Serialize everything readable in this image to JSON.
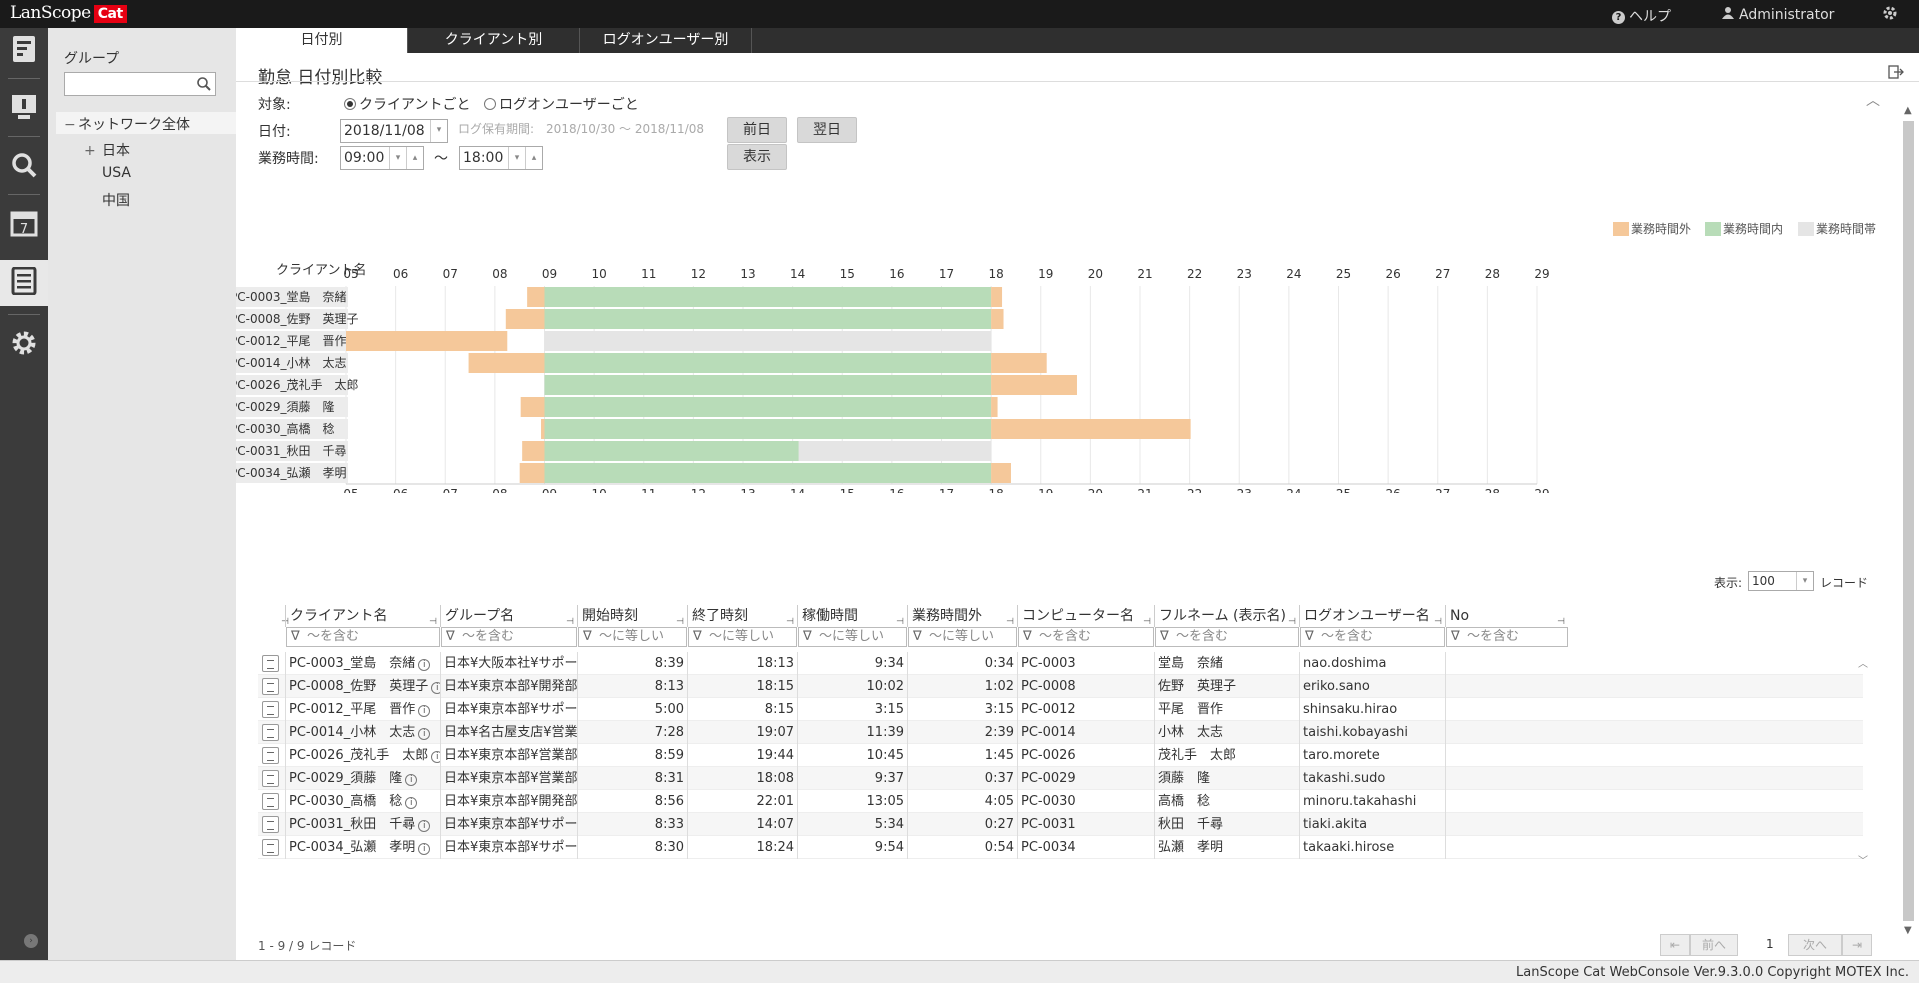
{
  "app": {
    "logo_text": "LanScope",
    "logo_badge": "Cat"
  },
  "topbar": {
    "help": "ヘルプ",
    "user": "Administrator"
  },
  "sidepanel": {
    "title": "グループ",
    "search_placeholder": "",
    "tree": [
      {
        "label": "ネットワーク全体",
        "toggle": "−"
      },
      {
        "label": "日本",
        "toggle": "+"
      },
      {
        "label": "USA",
        "toggle": ""
      },
      {
        "label": "中国",
        "toggle": ""
      }
    ]
  },
  "tabs": [
    {
      "label": "日付別",
      "active": true
    },
    {
      "label": "クライアント別",
      "active": false
    },
    {
      "label": "ログオンユーザー別",
      "active": false
    }
  ],
  "page": {
    "title": "勤怠 日付別比較"
  },
  "form": {
    "target_label": "対象:",
    "radio_client": "クライアントごと",
    "radio_user": "ログオンユーザーごと",
    "date_label": "日付:",
    "date_value": "2018/11/08",
    "log_period": "ログ保有期間:　2018/10/30 ～ 2018/11/08",
    "prev_button": "前日",
    "next_button": "翌日",
    "hours_label": "業務時間:",
    "start_time": "09:00",
    "tilde": "～",
    "end_time": "18:00",
    "show_button": "表示"
  },
  "legend": {
    "outside": "業務時間外",
    "inside": "業務時間内",
    "band": "業務時間帯",
    "outside_color": "#f5c89a",
    "inside_color": "#b8dcb8",
    "band_color": "#e5e5e5"
  },
  "chart_data": {
    "type": "bar",
    "title": "",
    "category_header": "クライアント名",
    "x_ticks": [
      "05",
      "06",
      "07",
      "08",
      "09",
      "10",
      "11",
      "12",
      "13",
      "14",
      "15",
      "16",
      "17",
      "18",
      "19",
      "20",
      "21",
      "22",
      "23",
      "24",
      "25",
      "26",
      "27",
      "28",
      "29"
    ],
    "xlim": [
      5,
      29
    ],
    "business_hours": [
      9,
      18
    ],
    "categories": [
      "PC-0003_堂島　奈緒",
      "PC-0008_佐野　英理子",
      "PC-0012_平尾　晋作",
      "PC-0014_小林　太志",
      "PC-0026_茂礼手　太郎",
      "PC-0029_須藤　隆",
      "PC-0030_高橋　稔",
      "PC-0031_秋田　千尋",
      "PC-0034_弘瀬　孝明"
    ],
    "series": [
      {
        "name": "業務時間外",
        "ranges": [
          [
            [
              8.65,
              9
            ],
            [
              18,
              18.22
            ]
          ],
          [
            [
              8.22,
              9
            ],
            [
              18,
              18.25
            ]
          ],
          [
            [
              5,
              8.25
            ]
          ],
          [
            [
              7.47,
              9
            ],
            [
              18,
              19.12
            ]
          ],
          [
            [
              9,
              9
            ],
            [
              18,
              19.73
            ]
          ],
          [
            [
              8.52,
              9
            ],
            [
              18,
              18.13
            ]
          ],
          [
            [
              8.93,
              9
            ],
            [
              18,
              22.02
            ]
          ],
          [
            [
              8.55,
              9
            ]
          ],
          [
            [
              8.5,
              9
            ],
            [
              18,
              18.4
            ]
          ]
        ]
      },
      {
        "name": "業務時間内",
        "ranges": [
          [
            [
              9,
              18
            ]
          ],
          [
            [
              9,
              18
            ]
          ],
          [],
          [
            [
              9,
              18
            ]
          ],
          [
            [
              9,
              18
            ]
          ],
          [
            [
              9,
              18
            ]
          ],
          [
            [
              9,
              18
            ]
          ],
          [
            [
              9,
              14.12
            ]
          ],
          [
            [
              9,
              18
            ]
          ]
        ]
      }
    ]
  },
  "grid": {
    "display_label": "表示:",
    "page_size": "100",
    "records_label": "レコード",
    "columns": [
      {
        "label": "クライアント名",
        "filter": "～を含む"
      },
      {
        "label": "グループ名",
        "filter": "～を含む"
      },
      {
        "label": "開始時刻",
        "filter": "～に等しい"
      },
      {
        "label": "終了時刻",
        "filter": "～に等しい"
      },
      {
        "label": "稼働時間",
        "filter": "～に等しい"
      },
      {
        "label": "業務時間外",
        "filter": "～に等しい"
      },
      {
        "label": "コンピューター名",
        "filter": "～を含む"
      },
      {
        "label": "フルネーム (表示名)",
        "filter": "～を含む"
      },
      {
        "label": "ログオンユーザー名",
        "filter": "～を含む"
      },
      {
        "label": "No",
        "filter": "～を含む"
      }
    ],
    "rows": [
      [
        "PC-0003_堂島　奈緒",
        "日本¥大阪本社¥サポート部",
        "8:39",
        "18:13",
        "9:34",
        "0:34",
        "PC-0003",
        "堂島　奈緒",
        "nao.doshima",
        ""
      ],
      [
        "PC-0008_佐野　英理子",
        "日本¥東京本部¥開発部",
        "8:13",
        "18:15",
        "10:02",
        "1:02",
        "PC-0008",
        "佐野　英理子",
        "eriko.sano",
        ""
      ],
      [
        "PC-0012_平尾　晋作",
        "日本¥東京本部¥サポート部",
        "5:00",
        "8:15",
        "3:15",
        "3:15",
        "PC-0012",
        "平尾　晋作",
        "shinsaku.hirao",
        ""
      ],
      [
        "PC-0014_小林　太志",
        "日本¥名古屋支店¥営業部",
        "7:28",
        "19:07",
        "11:39",
        "2:39",
        "PC-0014",
        "小林　太志",
        "taishi.kobayashi",
        ""
      ],
      [
        "PC-0026_茂礼手　太郎",
        "日本¥東京本部¥営業部",
        "8:59",
        "19:44",
        "10:45",
        "1:45",
        "PC-0026",
        "茂礼手　太郎",
        "taro.morete",
        ""
      ],
      [
        "PC-0029_須藤　隆",
        "日本¥東京本部¥営業部",
        "8:31",
        "18:08",
        "9:37",
        "0:37",
        "PC-0029",
        "須藤　隆",
        "takashi.sudo",
        ""
      ],
      [
        "PC-0030_高橋　稔",
        "日本¥東京本部¥開発部",
        "8:56",
        "22:01",
        "13:05",
        "4:05",
        "PC-0030",
        "高橋　稔",
        "minoru.takahashi",
        ""
      ],
      [
        "PC-0031_秋田　千尋",
        "日本¥東京本部¥サポート部",
        "8:33",
        "14:07",
        "5:34",
        "0:27",
        "PC-0031",
        "秋田　千尋",
        "tiaki.akita",
        ""
      ],
      [
        "PC-0034_弘瀬　孝明",
        "日本¥東京本部¥サポート部",
        "8:30",
        "18:24",
        "9:54",
        "0:54",
        "PC-0034",
        "弘瀬　孝明",
        "takaaki.hirose",
        ""
      ]
    ],
    "summary": "1 - 9 / 9 レコード",
    "pager": {
      "first": "⇤",
      "prev": "前へ",
      "page": "1",
      "next": "次へ",
      "last": "⇥"
    }
  },
  "footer": {
    "copyright": "LanScope Cat WebConsole Ver.9.3.0.0 Copyright MOTEX Inc."
  }
}
